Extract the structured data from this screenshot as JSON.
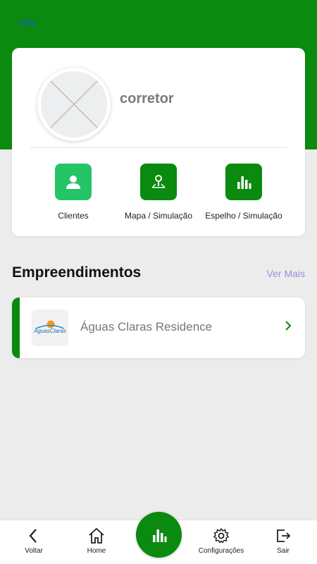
{
  "colors": {
    "brand": "#0a8a0e",
    "accent_light": "#25c466",
    "link": "#9c8fe0"
  },
  "profile": {
    "name": "corretor"
  },
  "actions": [
    {
      "label": "Clientes",
      "icon": "person-icon"
    },
    {
      "label": "Mapa / Simulação",
      "icon": "map-pin-icon"
    },
    {
      "label": "Espelho / Simulação",
      "icon": "bar-chart-icon"
    }
  ],
  "section": {
    "title": "Empreendimentos",
    "see_more": "Ver Mais"
  },
  "projects": [
    {
      "name": "Águas Claras Residence",
      "logo_text": "AguasClaras"
    }
  ],
  "bottom_nav": [
    {
      "label": "Voltar",
      "icon": "chevron-left-icon"
    },
    {
      "label": "Home",
      "icon": "home-icon"
    },
    {
      "label": "",
      "icon": "bar-chart-icon"
    },
    {
      "label": "Configurações",
      "icon": "gear-icon"
    },
    {
      "label": "Sair",
      "icon": "logout-icon"
    }
  ]
}
